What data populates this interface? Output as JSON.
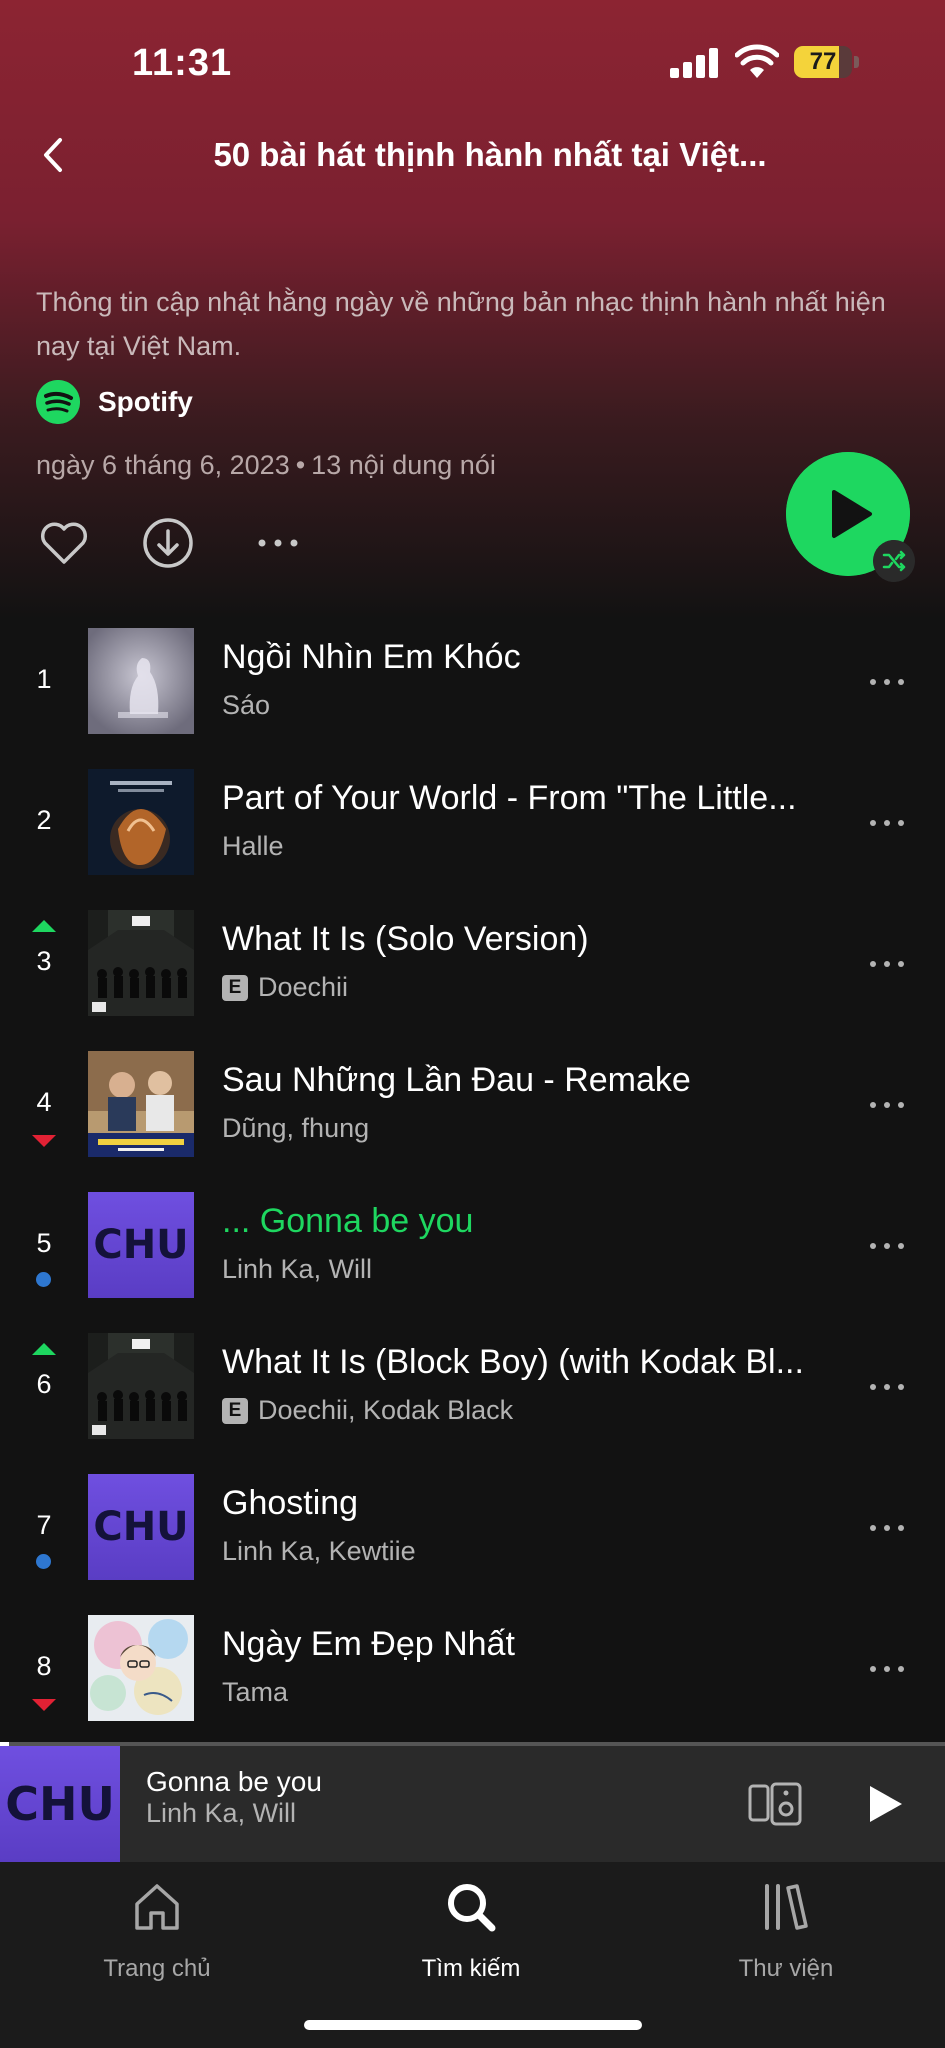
{
  "status_bar": {
    "time": "11:31",
    "battery": "77",
    "battery_level_pct": 77
  },
  "header": {
    "title": "50 bài hát thịnh hành nhất tại Việt..."
  },
  "playlist": {
    "description": "Thông tin cập nhật hằng ngày về những bản nhạc thịnh hành nhất hiện nay tại Việt Nam.",
    "owner": "Spotify",
    "date": "ngày 6 tháng 6, 2023",
    "separator": "•",
    "count": "13 nội dung nói"
  },
  "tracks": [
    {
      "rank": "1",
      "trend": "none",
      "title": "Ngồi Nhìn Em Khóc",
      "artist": "Sáo",
      "explicit": false,
      "playing": false,
      "cover": "ngoi"
    },
    {
      "rank": "2",
      "trend": "none",
      "title": "Part of Your World - From \"The Little...",
      "artist": "Halle",
      "explicit": false,
      "playing": false,
      "cover": "mermaid"
    },
    {
      "rank": "3",
      "trend": "up",
      "title": "What It Is (Solo Version)",
      "artist": "Doechii",
      "explicit": true,
      "playing": false,
      "cover": "whatitis"
    },
    {
      "rank": "4",
      "trend": "down",
      "title": "Sau Những Lần Đau - Remake",
      "artist": "Dũng, fhung",
      "explicit": false,
      "playing": false,
      "cover": "sau"
    },
    {
      "rank": "5",
      "trend": "new",
      "title": "... Gonna be you",
      "artist": "Linh Ka, Will",
      "explicit": false,
      "playing": true,
      "cover": "chu"
    },
    {
      "rank": "6",
      "trend": "up",
      "title": "What It Is (Block Boy) (with Kodak Bl...",
      "artist": "Doechii, Kodak Black",
      "explicit": true,
      "playing": false,
      "cover": "whatitis"
    },
    {
      "rank": "7",
      "trend": "new",
      "title": "Ghosting",
      "artist": "Linh Ka, Kewtiie",
      "explicit": false,
      "playing": false,
      "cover": "chu"
    },
    {
      "rank": "8",
      "trend": "down",
      "title": "Ngày Em Đẹp Nhất",
      "artist": "Tama",
      "explicit": false,
      "playing": false,
      "cover": "ngay"
    }
  ],
  "explicit_label": "E",
  "cover_chu_text": "CHU",
  "mini_player": {
    "title": "Gonna be you",
    "artist": "Linh Ka, Will",
    "progress_pct": 1
  },
  "tabs": [
    {
      "label": "Trang chủ",
      "icon": "home-icon",
      "active": false
    },
    {
      "label": "Tìm kiếm",
      "icon": "search-icon",
      "active": true
    },
    {
      "label": "Thư viện",
      "icon": "library-icon",
      "active": false
    }
  ],
  "colors": {
    "accent": "#1ed760",
    "header": "#8c2432",
    "background": "#121212",
    "trend_up": "#1ed760",
    "trend_down": "#e22134",
    "trend_new": "#2e77d0"
  }
}
